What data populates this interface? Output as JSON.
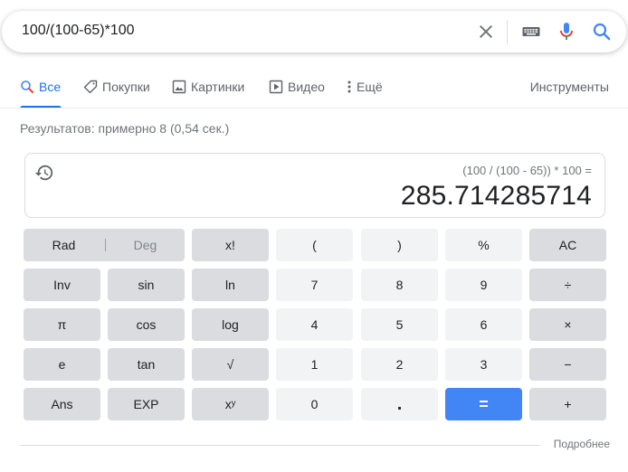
{
  "search": {
    "query": "100/(100-65)*100"
  },
  "icons": {
    "clear": "close-icon",
    "keyboard": "keyboard-icon",
    "mic": "microphone-icon",
    "search": "search-icon"
  },
  "colors": {
    "accent": "#1a73e8",
    "equals_button": "#4285f4",
    "function_key": "#dadce0",
    "number_key": "#f1f3f4"
  },
  "tabs": [
    {
      "label": "Все",
      "icon": "search-icon",
      "active": true
    },
    {
      "label": "Покупки",
      "icon": "tag-icon",
      "active": false
    },
    {
      "label": "Картинки",
      "icon": "image-icon",
      "active": false
    },
    {
      "label": "Видео",
      "icon": "play-icon",
      "active": false
    },
    {
      "label": "Ещё",
      "icon": "more-vert-icon",
      "active": false
    }
  ],
  "tools_label": "Инструменты",
  "result_stats": "Результатов: примерно 8 (0,54 сек.)",
  "calculator": {
    "expression": "(100 / (100 - 65)) * 100 =",
    "result": "285.714285714",
    "rad_label": "Rad",
    "deg_label": "Deg",
    "keys": [
      [
        "x!",
        "(",
        ")",
        "%",
        "AC"
      ],
      [
        "Inv",
        "sin",
        "ln",
        "7",
        "8",
        "9",
        "÷"
      ],
      [
        "π",
        "cos",
        "log",
        "4",
        "5",
        "6",
        "×"
      ],
      [
        "e",
        "tan",
        "√",
        "1",
        "2",
        "3",
        "−"
      ],
      [
        "Ans",
        "EXP",
        "xʸ",
        "0",
        ".",
        "=",
        "+"
      ]
    ]
  },
  "more_label": "Подробнее"
}
